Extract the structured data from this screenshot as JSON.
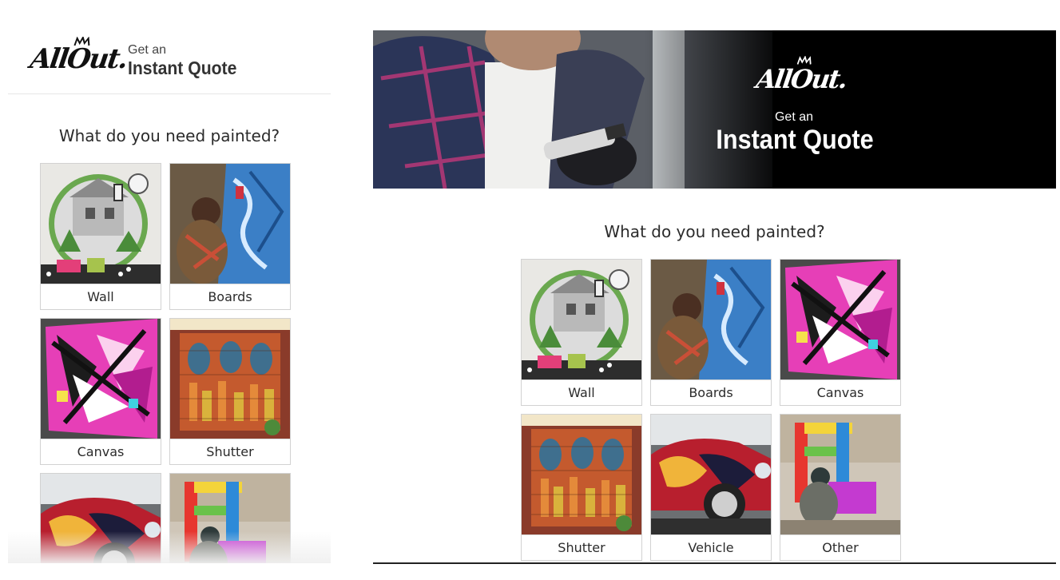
{
  "brand": {
    "logo_text": "AllOut."
  },
  "mobile": {
    "header": {
      "get_an": "Get an",
      "instant_quote": "Instant Quote"
    },
    "question": "What do you need painted?",
    "options": [
      {
        "label": "Wall",
        "image": "wall-mural"
      },
      {
        "label": "Boards",
        "image": "boards-artist"
      },
      {
        "label": "Canvas",
        "image": "canvas-graffiti"
      },
      {
        "label": "Shutter",
        "image": "shutter-mural"
      },
      {
        "label": "",
        "image": "vehicle-car"
      },
      {
        "label": "",
        "image": "other-sculpture"
      }
    ]
  },
  "desktop": {
    "hero": {
      "get_an": "Get an",
      "instant_quote": "Instant Quote"
    },
    "question": "What do you need painted?",
    "options": [
      {
        "label": "Wall",
        "image": "wall-mural"
      },
      {
        "label": "Boards",
        "image": "boards-artist"
      },
      {
        "label": "Canvas",
        "image": "canvas-graffiti"
      },
      {
        "label": "Shutter",
        "image": "shutter-mural"
      },
      {
        "label": "Vehicle",
        "image": "vehicle-car"
      },
      {
        "label": "Other",
        "image": "other-sculpture"
      }
    ]
  },
  "colors": {
    "hero_bg": "#000000",
    "card_border": "#d2d2d2",
    "text": "#2b2b2b"
  }
}
